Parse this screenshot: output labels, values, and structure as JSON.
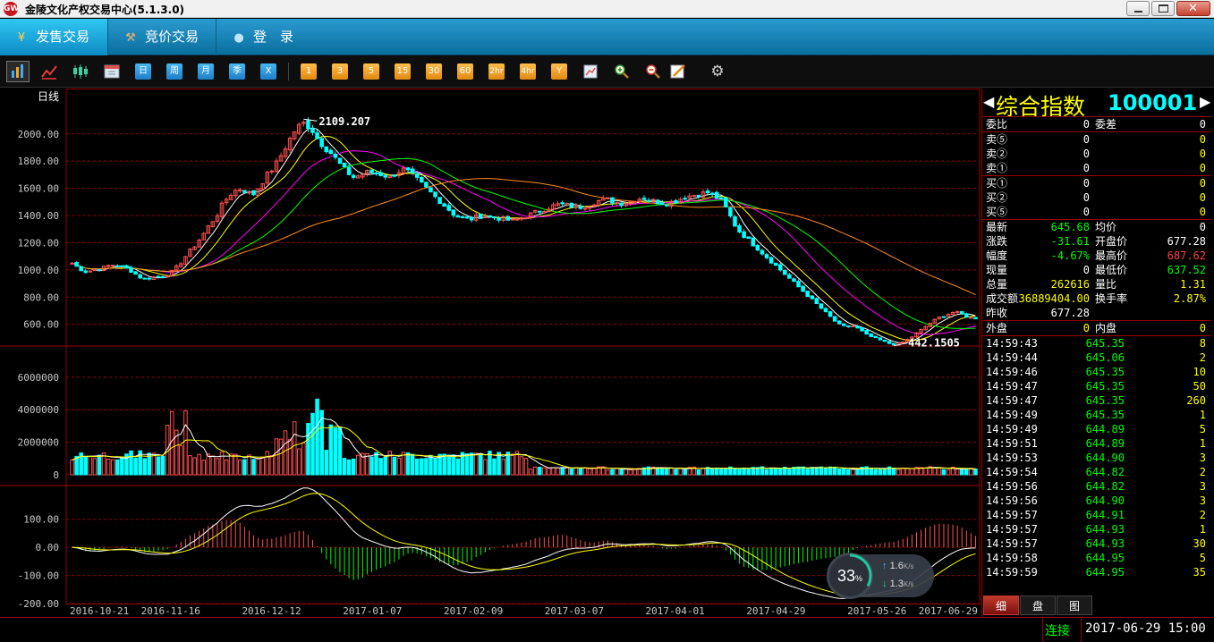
{
  "window": {
    "title": "金陵文化产权交易中心(5.1.3.0)",
    "logo_text": "GW"
  },
  "nav": {
    "items": [
      {
        "label": "发售交易",
        "icon": "yen-icon"
      },
      {
        "label": "竞价交易",
        "icon": "gavel-icon"
      },
      {
        "label": "登　录",
        "icon": "user-icon"
      }
    ]
  },
  "toolbar": {
    "period_buttons": [
      "日",
      "周",
      "月",
      "季",
      "X"
    ],
    "minute_buttons": [
      "1",
      "3",
      "5",
      "15",
      "30",
      "60",
      "2hr",
      "4hr",
      "Y"
    ]
  },
  "colors": {
    "up": "#ff5050",
    "down": "#00ffff",
    "ma5": "#ffffff",
    "ma10": "#ffff00",
    "ma20": "#ff00ff",
    "ma30": "#00ff00",
    "ma60": "#ff8c1a",
    "grid": "#9b0000",
    "axis_text": "#c8c8c8"
  },
  "chart_data": {
    "type": "candlestick",
    "period_label": "日线",
    "price_axis": {
      "ticks": [
        "2000.00",
        "1800.00",
        "1600.00",
        "1400.00",
        "1200.00",
        "1000.00",
        "800.00",
        "600.00"
      ],
      "ylim": [
        440,
        2130
      ]
    },
    "volume_axis": {
      "ticks": [
        "6000000",
        "4000000",
        "2000000",
        "0"
      ],
      "ylim": [
        0,
        7200000
      ]
    },
    "macd_axis": {
      "ticks": [
        "100.00",
        "0.00",
        "-100.00",
        "-200.00"
      ],
      "ylim": [
        -200,
        150
      ]
    },
    "x_labels": [
      "2016-10-21",
      "2016-11-16",
      "2016-12-12",
      "2017-01-07",
      "2017-02-09",
      "2017-03-07",
      "2017-04-01",
      "2017-04-29",
      "2017-05-26",
      "2017-06-29"
    ],
    "high_annotation": "2109.207",
    "low_annotation": "442.1505",
    "close_keypoints": [
      1050,
      1010,
      985,
      1000,
      1010,
      1030,
      1040,
      1020,
      1000,
      960,
      930,
      945,
      950,
      960,
      990,
      1050,
      1120,
      1180,
      1250,
      1330,
      1400,
      1500,
      1560,
      1600,
      1580,
      1550,
      1620,
      1700,
      1760,
      1850,
      1950,
      2040,
      2080,
      2050,
      1960,
      1900,
      1850,
      1780,
      1720,
      1680,
      1700,
      1720,
      1710,
      1700,
      1680,
      1720,
      1740,
      1700,
      1650,
      1600,
      1550,
      1500,
      1450,
      1400,
      1380,
      1370,
      1390,
      1400,
      1390,
      1380,
      1370,
      1360,
      1380,
      1400,
      1420,
      1440,
      1460,
      1480,
      1480,
      1470,
      1460,
      1470,
      1490,
      1510,
      1520,
      1500,
      1490,
      1500,
      1520,
      1530,
      1510,
      1500,
      1490,
      1500,
      1520,
      1540,
      1550,
      1560,
      1570,
      1540,
      1500,
      1400,
      1300,
      1250,
      1200,
      1150,
      1100,
      1050,
      1000,
      950,
      900,
      850,
      800,
      750,
      700,
      650,
      600,
      580,
      590,
      560,
      520,
      500,
      480,
      460,
      450,
      470,
      500,
      540,
      580,
      620,
      650,
      670,
      690,
      680,
      650,
      645
    ]
  },
  "quote_panel": {
    "title": "综合指数",
    "code": "100001",
    "rows1": [
      {
        "label": "委比",
        "value": "0",
        "label2": "委差",
        "value2": "0"
      }
    ],
    "sell": [
      {
        "label": "卖⑤",
        "price": "0",
        "vol": "0"
      },
      {
        "label": "卖②",
        "price": "0",
        "vol": "0"
      },
      {
        "label": "卖①",
        "price": "0",
        "vol": "0"
      }
    ],
    "buy": [
      {
        "label": "买①",
        "price": "0",
        "vol": "0"
      },
      {
        "label": "买②",
        "price": "0",
        "vol": "0"
      },
      {
        "label": "买⑤",
        "price": "0",
        "vol": "0"
      }
    ],
    "stats": [
      {
        "l1": "最新",
        "v1": "645.68",
        "c1": "#00ff00",
        "l2": "均价",
        "v2": "0",
        "c2": "#ffffff"
      },
      {
        "l1": "涨跌",
        "v1": "-31.61",
        "c1": "#00ff00",
        "l2": "开盘价",
        "v2": "677.28",
        "c2": "#ffffff"
      },
      {
        "l1": "幅度",
        "v1": "-4.67%",
        "c1": "#00ff00",
        "l2": "最高价",
        "v2": "687.62",
        "c2": "#ff4040"
      },
      {
        "l1": "现量",
        "v1": "0",
        "c1": "#ffffff",
        "l2": "最低价",
        "v2": "637.52",
        "c2": "#00ff00"
      },
      {
        "l1": "总量",
        "v1": "262616",
        "c1": "#ffff00",
        "l2": "量比",
        "v2": "1.31",
        "c2": "#ffff00"
      },
      {
        "l1": "成交额",
        "v1": "36889404.00",
        "c1": "#ffff00",
        "l2": "换手率",
        "v2": "2.87%",
        "c2": "#ffff00"
      },
      {
        "l1": "昨收",
        "v1": "677.28",
        "c1": "#ffffff",
        "l2": "",
        "v2": "",
        "c2": "#ffffff"
      }
    ],
    "outer": {
      "l1": "外盘",
      "v1": "0",
      "l2": "内盘",
      "v2": "0"
    },
    "ticks": [
      [
        "14:59:43",
        "645.35",
        "8"
      ],
      [
        "14:59:44",
        "645.06",
        "2"
      ],
      [
        "14:59:46",
        "645.35",
        "10"
      ],
      [
        "14:59:47",
        "645.35",
        "50"
      ],
      [
        "14:59:47",
        "645.35",
        "260"
      ],
      [
        "14:59:49",
        "645.35",
        "1"
      ],
      [
        "14:59:49",
        "644.89",
        "5"
      ],
      [
        "14:59:51",
        "644.89",
        "1"
      ],
      [
        "14:59:53",
        "644.90",
        "3"
      ],
      [
        "14:59:54",
        "644.82",
        "2"
      ],
      [
        "14:59:56",
        "644.82",
        "3"
      ],
      [
        "14:59:56",
        "644.90",
        "3"
      ],
      [
        "14:59:57",
        "644.91",
        "2"
      ],
      [
        "14:59:57",
        "644.93",
        "1"
      ],
      [
        "14:59:57",
        "644.93",
        "30"
      ],
      [
        "14:59:58",
        "644.95",
        "5"
      ],
      [
        "14:59:59",
        "644.95",
        "35"
      ]
    ],
    "tabs": [
      "细",
      "盘",
      "图"
    ]
  },
  "speed": {
    "percent": "33",
    "percent_unit": "%",
    "up": "1.6",
    "down": "1.3",
    "unit": "K/s"
  },
  "status": {
    "connection": "连接",
    "datetime": "2017-06-29 15:00"
  }
}
